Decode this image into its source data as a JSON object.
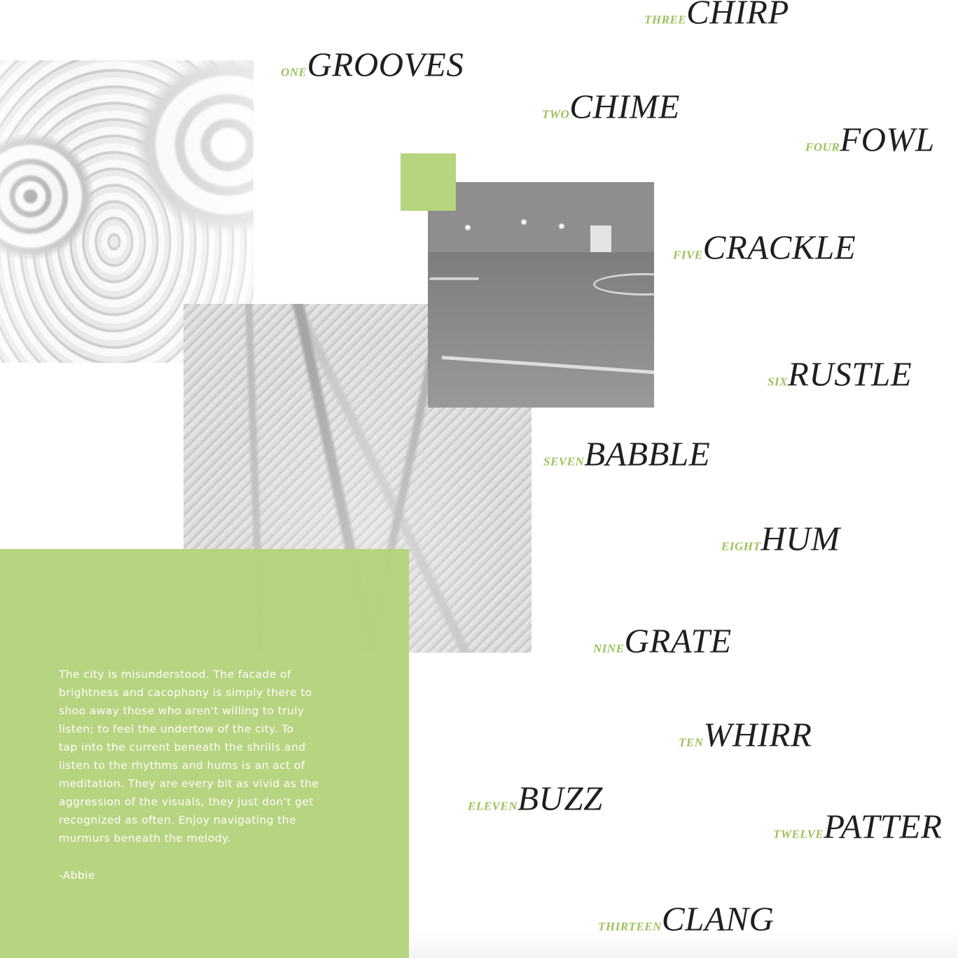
{
  "essay": {
    "lines": [
      "The city is misunderstood. The facade of",
      "brightness and cacophony is simply there to",
      "shoo away those who aren't willing to truly",
      "listen; to feel the undertow of the city. To",
      "tap into the current beneath the shrills and",
      "listen to the rhythms and hums is an act of",
      "meditation. They are every bit as vivid as the",
      "aggression of the visuals, they just don't get",
      "recognized as often. Enjoy navigating the",
      "murmurs beneath the melody."
    ],
    "signature": "-Abbie"
  },
  "sounds": [
    {
      "num": "one",
      "word": "GROOVES"
    },
    {
      "num": "two",
      "word": "CHIME"
    },
    {
      "num": "three",
      "word": "CHIRP"
    },
    {
      "num": "four",
      "word": "FOWL"
    },
    {
      "num": "five",
      "word": "CRACKLE"
    },
    {
      "num": "six",
      "word": "RUSTLE"
    },
    {
      "num": "seven",
      "word": "BABBLE"
    },
    {
      "num": "eight",
      "word": "HUM"
    },
    {
      "num": "nine",
      "word": "GRATE"
    },
    {
      "num": "ten",
      "word": "WHIRR"
    },
    {
      "num": "eleven",
      "word": "BUZZ"
    },
    {
      "num": "twelve",
      "word": "PATTER"
    },
    {
      "num": "thirteen",
      "word": "CLANG"
    }
  ],
  "colors": {
    "accent_green": "#b5d37c",
    "number_green": "#9cc25a",
    "word_ink": "#1f1f1f"
  }
}
